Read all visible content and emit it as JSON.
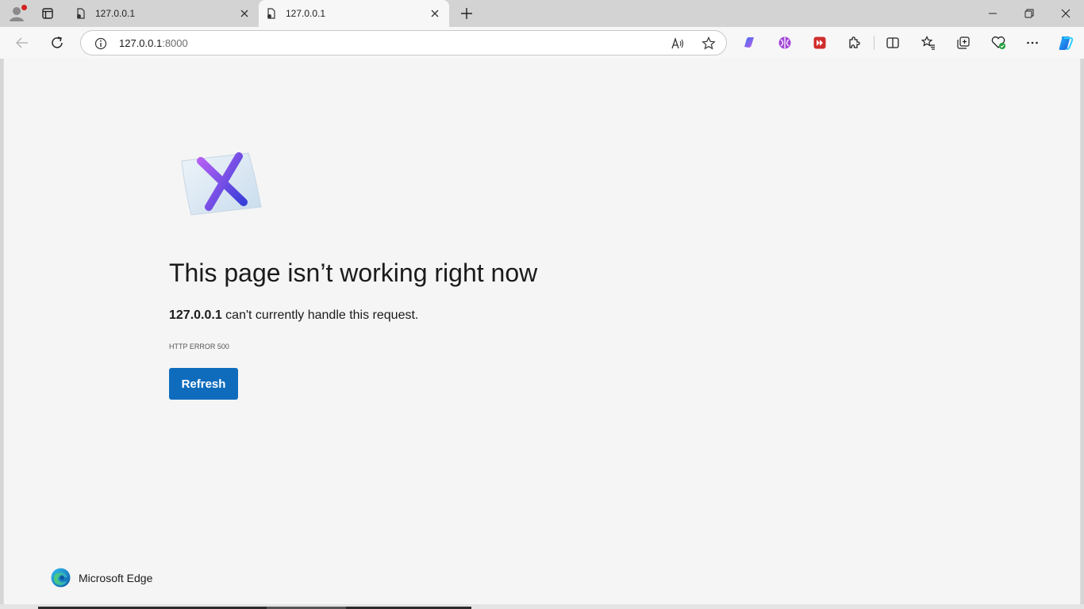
{
  "tabs": [
    {
      "title": "127.0.0.1",
      "active": false
    },
    {
      "title": "127.0.0.1",
      "active": true
    }
  ],
  "address_bar": {
    "host": "127.0.0.1",
    "port": ":8000"
  },
  "error_page": {
    "title": "This page isn’t working right now",
    "host_bold": "127.0.0.1",
    "message_rest": " can't currently handle this request.",
    "error_code": "HTTP ERROR 500",
    "refresh_label": "Refresh"
  },
  "brand": {
    "name": "Microsoft Edge"
  },
  "colors": {
    "accent": "#0f6cbd",
    "page_background": "#f5f5f5",
    "tabstrip": "#d3d3d3"
  },
  "icons": [
    "profile-icon",
    "tab-actions-icon",
    "page-favicon-icon",
    "close-icon",
    "new-tab-icon",
    "minimize-icon",
    "restore-icon",
    "window-close-icon",
    "back-icon",
    "refresh-icon",
    "info-icon",
    "read-aloud-icon",
    "favorite-star-icon",
    "extension-icons",
    "split-screen-icon",
    "favorites-icon",
    "collections-icon",
    "browser-essentials-icon",
    "more-icon",
    "copilot-icon",
    "error-illustration-icon",
    "edge-logo-icon"
  ]
}
